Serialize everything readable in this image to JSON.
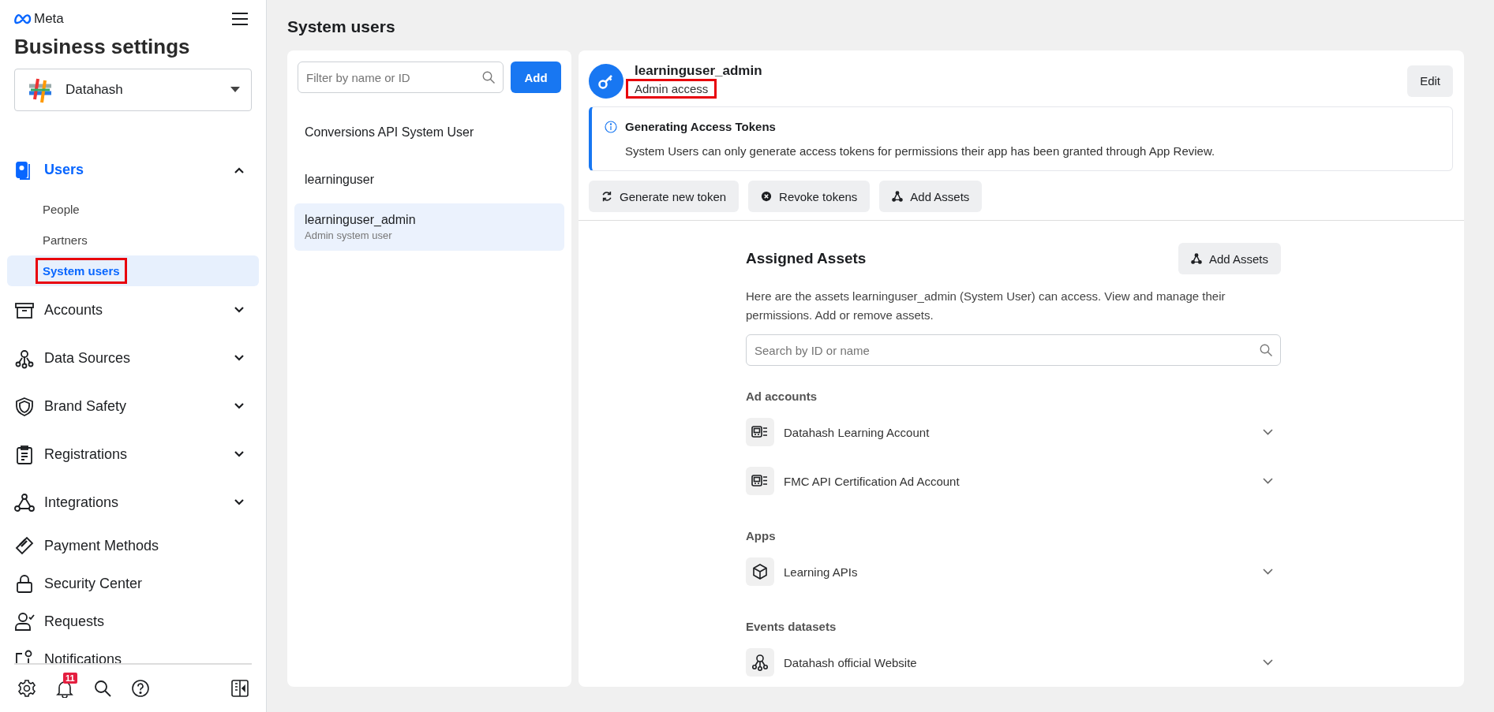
{
  "sidebar": {
    "brand": "Meta",
    "title": "Business settings",
    "account": {
      "name": "Datahash"
    },
    "nav": [
      {
        "label": "Users",
        "kind": "group",
        "expanded": true,
        "selected": true,
        "children": [
          {
            "label": "People",
            "selected": false,
            "highlighted": false
          },
          {
            "label": "Partners",
            "selected": false,
            "highlighted": false
          },
          {
            "label": "System users",
            "selected": true,
            "highlighted": true
          }
        ]
      },
      {
        "label": "Accounts",
        "kind": "group",
        "expanded": false,
        "selected": false
      },
      {
        "label": "Data Sources",
        "kind": "group",
        "expanded": false,
        "selected": false
      },
      {
        "label": "Brand Safety",
        "kind": "group",
        "expanded": false,
        "selected": false
      },
      {
        "label": "Registrations",
        "kind": "group",
        "expanded": false,
        "selected": false
      },
      {
        "label": "Integrations",
        "kind": "group",
        "expanded": false,
        "selected": false
      },
      {
        "label": "Payment Methods",
        "kind": "link",
        "selected": false
      },
      {
        "label": "Security Center",
        "kind": "link",
        "selected": false
      },
      {
        "label": "Requests",
        "kind": "link",
        "selected": false
      },
      {
        "label": "Notifications",
        "kind": "link",
        "selected": false
      }
    ],
    "notification_count": "11"
  },
  "page": {
    "title": "System users"
  },
  "user_list": {
    "filter_placeholder": "Filter by name or ID",
    "add_button": "Add",
    "users": [
      {
        "name": "Conversions API System User",
        "selected": false
      },
      {
        "name": "learninguser",
        "selected": false
      },
      {
        "name": "learninguser_admin",
        "subtitle": "Admin system user",
        "selected": true
      }
    ]
  },
  "detail": {
    "name": "learninguser_admin",
    "role": "Admin access",
    "role_highlighted": true,
    "edit_button": "Edit",
    "notice": {
      "title": "Generating Access Tokens",
      "body": "System Users can only generate access tokens for permissions their app has been granted through App Review."
    },
    "actions": [
      {
        "label": "Generate new token",
        "kind": "refresh"
      },
      {
        "label": "Revoke tokens",
        "kind": "revoke"
      },
      {
        "label": "Add Assets",
        "kind": "add"
      }
    ],
    "assets": {
      "title": "Assigned Assets",
      "add_button": "Add Assets",
      "description": "Here are the assets learninguser_admin (System User) can access. View and manage their permissions. Add or remove assets.",
      "search_placeholder": "Search by ID or name",
      "groups": [
        {
          "label": "Ad accounts",
          "items": [
            {
              "name": "Datahash Learning Account",
              "kind": "ad-account"
            },
            {
              "name": "FMC API Certification Ad Account",
              "kind": "ad-account"
            }
          ]
        },
        {
          "label": "Apps",
          "items": [
            {
              "name": "Learning APIs",
              "kind": "app"
            }
          ]
        },
        {
          "label": "Events datasets",
          "items": [
            {
              "name": "Datahash official Website",
              "kind": "dataset"
            }
          ]
        }
      ]
    }
  }
}
